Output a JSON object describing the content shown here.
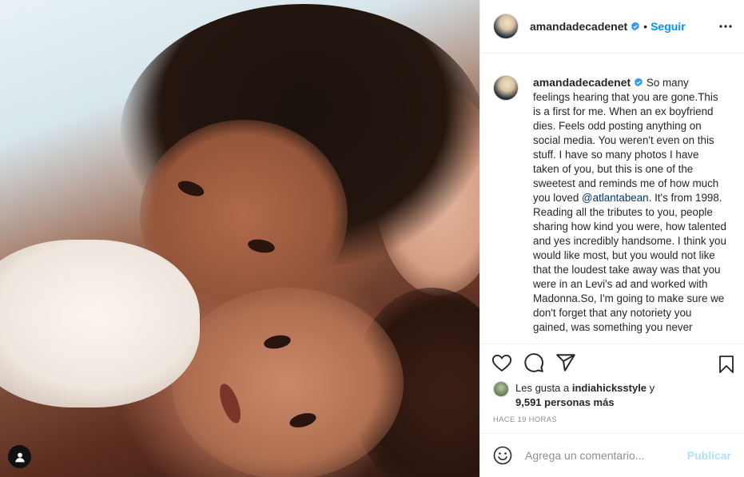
{
  "post": {
    "photo_alt": "Photo of two people lying together",
    "tag_icon": "user-tag-icon"
  },
  "header": {
    "username": "amandadecadenet",
    "separator": "•",
    "follow_label": "Seguir",
    "more_icon": "more-options-icon"
  },
  "caption": {
    "username": "amandadecadenet",
    "text_before": "So many feelings hearing that you are gone.This is a first for me. When an ex boyfriend dies. Feels odd posting anything on social media. You weren't even on this stuff. I have so many photos I have taken of you, but this is one of the sweetest and reminds me of how much you loved ",
    "mention": "@atlantabean",
    "text_after": ". It's from 1998. Reading all the tributes to you, people sharing how kind you were, how talented and yes incredibly handsome. I think you would like most, but you would not like that the loudest take away was that you were in an Levi's ad and worked with Madonna.So, I'm going to make sure we don't forget that any notoriety you gained, was something you never"
  },
  "actions": {
    "like_icon": "heart-icon",
    "comment_icon": "comment-icon",
    "share_icon": "share-icon",
    "save_icon": "bookmark-icon"
  },
  "likes": {
    "prefix": "Les gusta a ",
    "user": "indiahicksstyle",
    "suffix": " y",
    "others": "9,591 personas más"
  },
  "timestamp": "HACE 19 HORAS",
  "comment": {
    "placeholder": "Agrega un comentario...",
    "post_label": "Publicar",
    "emoji_icon": "emoji-icon"
  },
  "colors": {
    "accent": "#0095f6",
    "verified": "#3897f0",
    "muted": "#8e8e8e",
    "post_disabled": "#b2dffc"
  }
}
